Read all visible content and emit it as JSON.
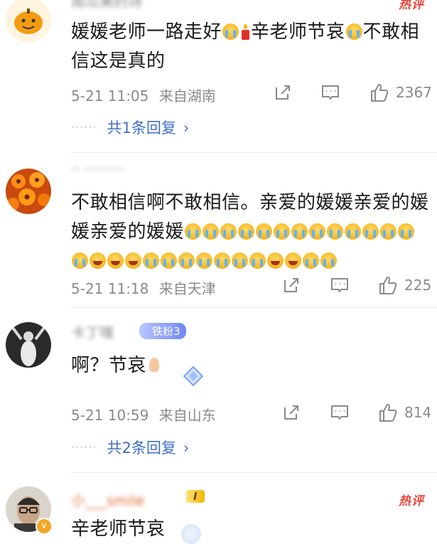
{
  "comments": [
    {
      "username": "南瓜美的诗",
      "hot": "热评",
      "text_parts": [
        "媛媛老师一路走好",
        "辛老师节哀",
        "不敢相信这是真的"
      ],
      "time": "5-21 11:05",
      "location": "来自湖南",
      "likes": "2367",
      "replies": "共1条回复"
    },
    {
      "username": "·· ·········",
      "text_line1": "不敢相信啊不敢相信。亲爱的媛媛亲爱的媛",
      "text_line2": "媛亲爱的媛媛",
      "time": "5-21 11:18",
      "location": "来自天津",
      "likes": "225"
    },
    {
      "username": "卡丁嘿",
      "fan_badge": "铁粉3",
      "text": "啊？节哀",
      "time": "5-21 10:59",
      "location": "来自山东",
      "likes": "814",
      "replies": "共2条回复"
    },
    {
      "username": "小___smile",
      "level_badge": "I",
      "hot": "热评",
      "text": "辛老师节哀"
    }
  ],
  "icons": {
    "repost": "repost-icon",
    "comment": "comment-icon",
    "like": "thumbs-up-icon",
    "chevron": "chevron-right-icon"
  },
  "colors": {
    "link": "#3e6fc7",
    "meta": "#8a8a8a",
    "hot": "#e8453c"
  }
}
